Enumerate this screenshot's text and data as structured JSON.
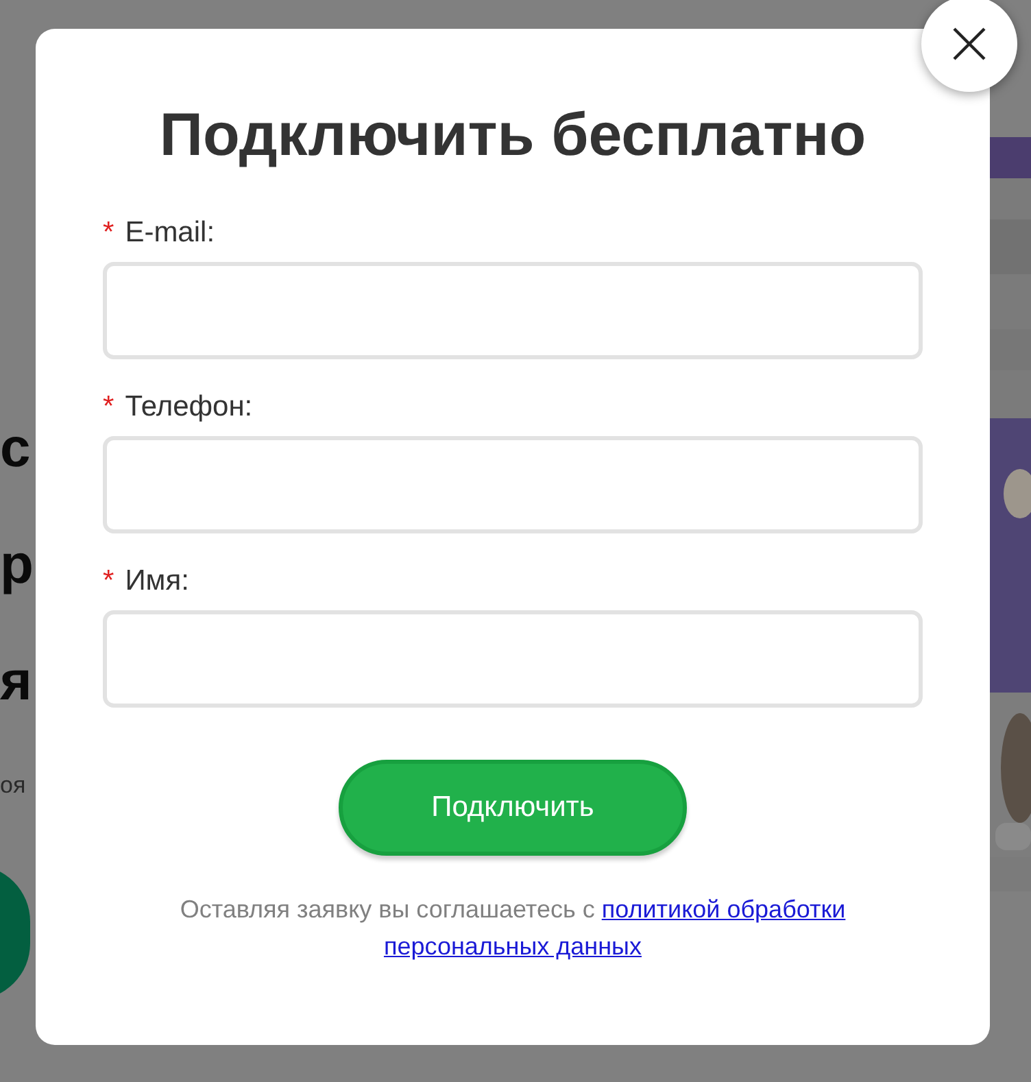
{
  "background": {
    "fragments": [
      {
        "kind": "heading",
        "text": "с"
      },
      {
        "kind": "heading",
        "text": "р"
      },
      {
        "kind": "heading",
        "text": "я"
      },
      {
        "kind": "body",
        "text": "оя"
      }
    ]
  },
  "modal": {
    "title": "Подключить бесплатно",
    "fields": [
      {
        "label": "E-mail:",
        "required": true
      },
      {
        "label": "Телефон:",
        "required": true
      },
      {
        "label": "Имя:",
        "required": true
      }
    ],
    "required_mark": "*",
    "submit": "Подключить",
    "consent": {
      "text": "Оставляя заявку вы соглашаетесь с",
      "link_lines": [
        "политикой обработки",
        "персональных данных"
      ]
    }
  }
}
